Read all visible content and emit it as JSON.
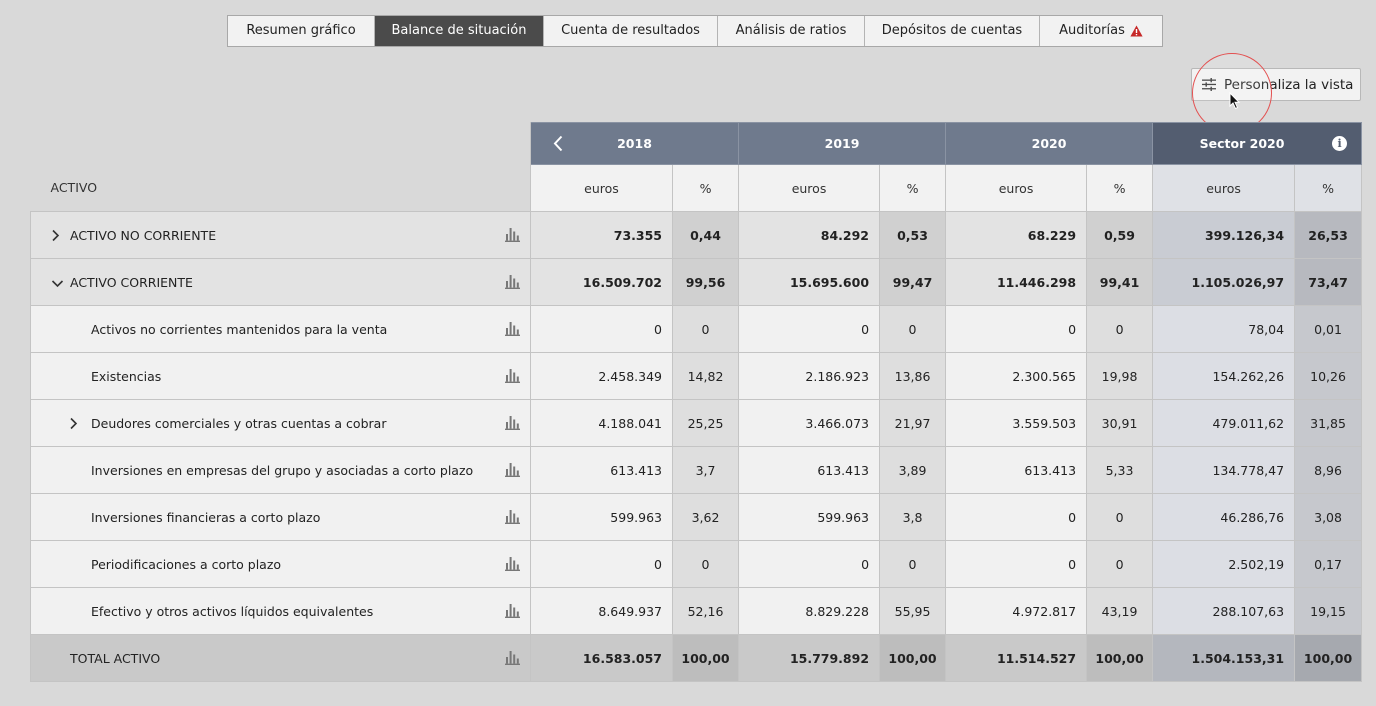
{
  "tabs": [
    {
      "label": "Resumen gráfico",
      "active": false
    },
    {
      "label": "Balance de situación",
      "active": true
    },
    {
      "label": "Cuenta de resultados",
      "active": false
    },
    {
      "label": "Análisis de ratios",
      "active": false
    },
    {
      "label": "Depósitos de cuentas",
      "active": false
    },
    {
      "label": "Auditorías",
      "active": false,
      "icon": "warning-icon"
    }
  ],
  "personaliza": {
    "label": "Personaliza la vista",
    "icon": "sliders-icon"
  },
  "table": {
    "section_label": "ACTIVO",
    "years": [
      "2018",
      "2019",
      "2020",
      "Sector 2020"
    ],
    "unit_euros": "euros",
    "unit_pct": "%",
    "rows": [
      {
        "label": "ACTIVO NO CORRIENTE",
        "kind": "group",
        "chevron": "right",
        "values": [
          "73.355",
          "0,44",
          "84.292",
          "0,53",
          "68.229",
          "0,59",
          "399.126,34",
          "26,53"
        ]
      },
      {
        "label": "ACTIVO CORRIENTE",
        "kind": "group",
        "chevron": "down",
        "values": [
          "16.509.702",
          "99,56",
          "15.695.600",
          "99,47",
          "11.446.298",
          "99,41",
          "1.105.026,97",
          "73,47"
        ]
      },
      {
        "label": "Activos no corrientes mantenidos para la venta",
        "kind": "sub",
        "values": [
          "0",
          "0",
          "0",
          "0",
          "0",
          "0",
          "78,04",
          "0,01"
        ]
      },
      {
        "label": "Existencias",
        "kind": "sub",
        "values": [
          "2.458.349",
          "14,82",
          "2.186.923",
          "13,86",
          "2.300.565",
          "19,98",
          "154.262,26",
          "10,26"
        ]
      },
      {
        "label": "Deudores comerciales y otras cuentas a cobrar",
        "kind": "sub",
        "chevron": "right",
        "values": [
          "4.188.041",
          "25,25",
          "3.466.073",
          "21,97",
          "3.559.503",
          "30,91",
          "479.011,62",
          "31,85"
        ]
      },
      {
        "label": "Inversiones en empresas del grupo y asociadas a corto plazo",
        "kind": "sub",
        "values": [
          "613.413",
          "3,7",
          "613.413",
          "3,89",
          "613.413",
          "5,33",
          "134.778,47",
          "8,96"
        ]
      },
      {
        "label": "Inversiones financieras a corto plazo",
        "kind": "sub",
        "values": [
          "599.963",
          "3,62",
          "599.963",
          "3,8",
          "0",
          "0",
          "46.286,76",
          "3,08"
        ]
      },
      {
        "label": "Periodificaciones a corto plazo",
        "kind": "sub",
        "values": [
          "0",
          "0",
          "0",
          "0",
          "0",
          "0",
          "2.502,19",
          "0,17"
        ]
      },
      {
        "label": "Efectivo y otros activos líquidos equivalentes",
        "kind": "sub",
        "values": [
          "8.649.937",
          "52,16",
          "8.829.228",
          "55,95",
          "4.972.817",
          "43,19",
          "288.107,63",
          "19,15"
        ]
      },
      {
        "label": "TOTAL ACTIVO",
        "kind": "total",
        "values": [
          "16.583.057",
          "100,00",
          "15.779.892",
          "100,00",
          "11.514.527",
          "100,00",
          "1.504.153,31",
          "100,00"
        ]
      }
    ]
  }
}
